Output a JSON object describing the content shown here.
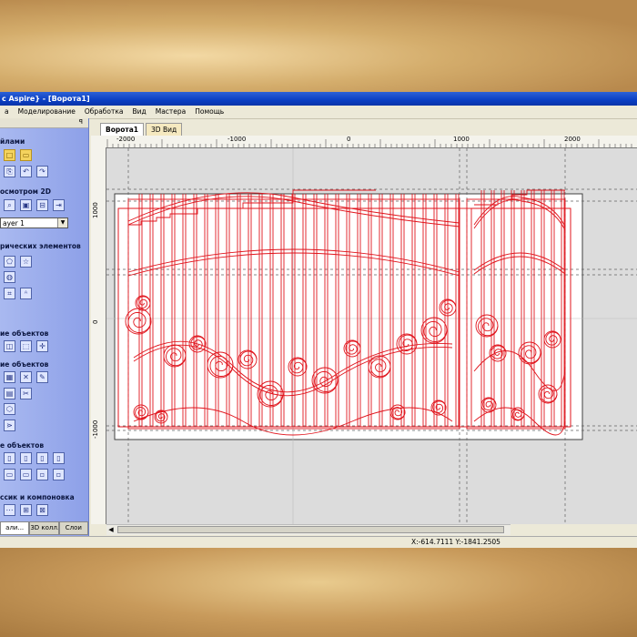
{
  "window": {
    "title": "c Aspire} - [Ворота1]"
  },
  "menu": [
    "а",
    "Моделирование",
    "Обработка",
    "Вид",
    "Мастера",
    "Помощь"
  ],
  "sidebar": {
    "pin": "ꟼ",
    "sections": [
      {
        "label": "йлами"
      },
      {
        "label": "осмотром 2D"
      },
      {
        "label": "рических элементов"
      },
      {
        "label": "ие объектов"
      },
      {
        "label": "ие объектов"
      },
      {
        "label": "е объектов"
      },
      {
        "label": "ссик и компоновка"
      }
    ],
    "layer_select": "ayer 1",
    "tabs": [
      "али...",
      "3D колл...",
      "Слои"
    ]
  },
  "doc_tabs": [
    "Ворота1",
    "3D Вид"
  ],
  "ruler": {
    "top_labels": [
      "-2000",
      "-1000",
      "0",
      "1000",
      "2000"
    ],
    "left_labels": [
      "1000",
      "0",
      "-1000"
    ]
  },
  "status": {
    "coords": "X:-614.7111 Y:-1841.2505"
  },
  "colors": {
    "title_bar": "#0a3fc4",
    "sidebar": "#8da0e8",
    "vector": "#e0141c",
    "canvas_bg": "#dcdcdc"
  }
}
